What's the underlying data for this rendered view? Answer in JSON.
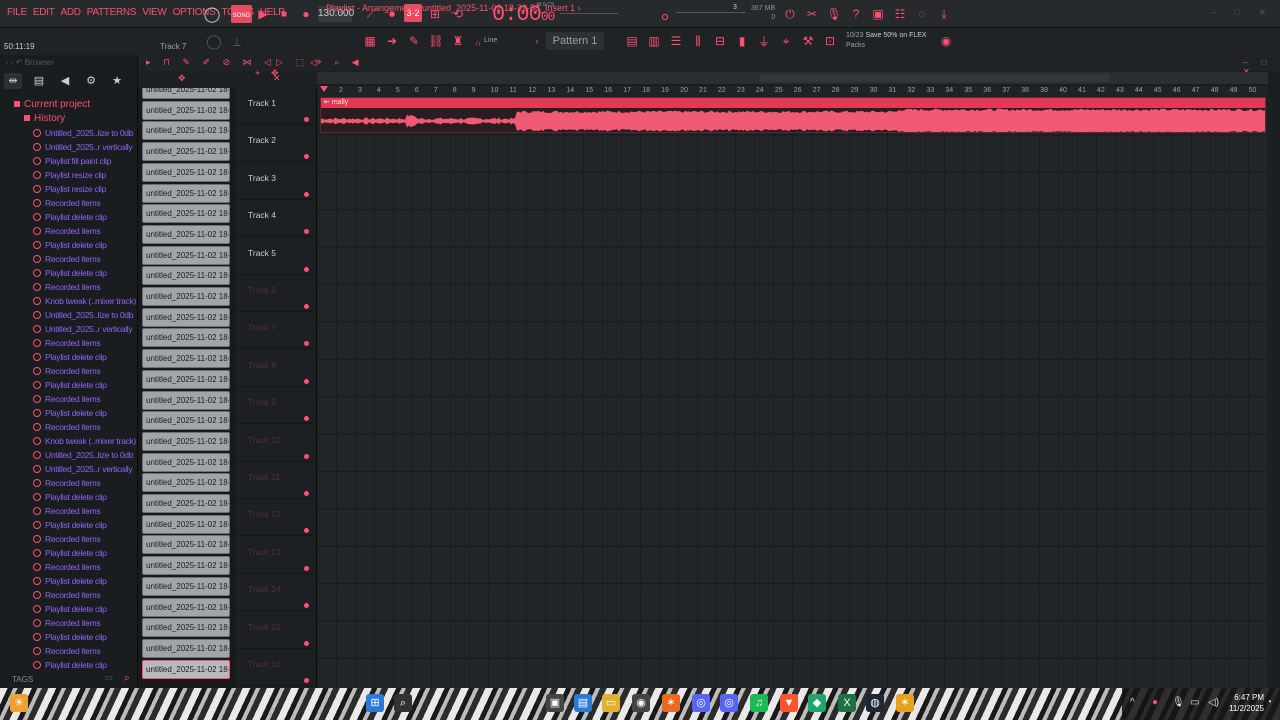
{
  "menu": [
    "FILE",
    "EDIT",
    "ADD",
    "PATTERNS",
    "VIEW",
    "OPTIONS",
    "TOOLS",
    "HELP"
  ],
  "transport": {
    "mode_label": "SONG",
    "tempo": "130.000",
    "time_main": "0:00",
    "time_sub": "00",
    "time_unit": "M:S:CS",
    "cpu": "3",
    "mem": "367 MB",
    "mem_sub": "0"
  },
  "toolbar2": {
    "hint_time": "50:11:19",
    "hint_track": "Track 7",
    "line_mode": "Line",
    "pattern": "Pattern 1",
    "promo_count": "10/23",
    "promo_text": "Save 50% on FLEX",
    "promo_sub": "Packs"
  },
  "browser": {
    "title": "Browser",
    "root": "Current project",
    "history_label": "History",
    "tags_label": "TAGS",
    "history_items": [
      "Untitled_2025..lize to 0db",
      "Untitled_2025..r vertically",
      "Playlist fill paint clip",
      "Playlist resize clip",
      "Playlist resize clip",
      "Recorded items",
      "Playlist delete clip",
      "Recorded items",
      "Playlist delete clip",
      "Recorded items",
      "Playlist delete clip",
      "Recorded items",
      "Knob tweak (..mixer track)",
      "Untitled_2025..lize to 0db",
      "Untitled_2025..r vertically",
      "Recorded items",
      "Playlist delete clip",
      "Recorded items",
      "Playlist delete clip",
      "Recorded items",
      "Playlist delete clip",
      "Recorded items",
      "Knob tweak (..mixer track)",
      "Untitled_2025..lize to 0db",
      "Untitled_2025..r vertically",
      "Recorded items",
      "Playlist delete clip",
      "Recorded items",
      "Playlist delete clip",
      "Recorded items",
      "Playlist delete clip",
      "Recorded items",
      "Playlist delete clip",
      "Recorded items",
      "Playlist delete clip",
      "Recorded items",
      "Playlist delete clip",
      "Recorded items",
      "Playlist delete clip"
    ]
  },
  "playlist": {
    "title": "Playlist - Arrangement › untitled_2025-11-02 18-32-58_Insert 1 ›",
    "clip_name": "untitled_2025-11-02 18-...",
    "clip_count": 29,
    "audio_clip_label": "mally",
    "tracks": [
      "Track 1",
      "Track 2",
      "Track 3",
      "Track 4",
      "Track 5",
      "Track 6",
      "Track 7",
      "Track 8",
      "Track 9",
      "Track 10",
      "Track 11",
      "Track 12",
      "Track 13",
      "Track 14",
      "Track 15",
      "Track 16"
    ],
    "active_tracks": 5,
    "bars": [
      "2",
      "3",
      "4",
      "5",
      "6",
      "7",
      "8",
      "9",
      "10",
      "11",
      "12",
      "13",
      "14",
      "15",
      "16",
      "17",
      "18",
      "19",
      "20",
      "21",
      "22",
      "23",
      "24",
      "25",
      "26",
      "27",
      "28",
      "29",
      "30",
      "31",
      "32",
      "33",
      "34",
      "35",
      "36",
      "37",
      "38",
      "39",
      "40",
      "41",
      "42",
      "43",
      "44",
      "45",
      "46",
      "47",
      "48",
      "49",
      "50"
    ]
  },
  "taskbar": {
    "time": "6:47 PM",
    "date": "11/2/2025"
  },
  "colors": {
    "accent": "#ff4f6e",
    "clip": "#f05a72",
    "history_text": "#8f63f0",
    "bg": "#1b1e21"
  }
}
